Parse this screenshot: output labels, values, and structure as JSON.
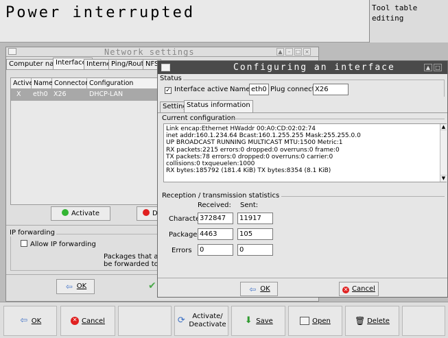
{
  "header": {
    "title": "Power interrupted",
    "mode_label": "Tool table\nediting"
  },
  "network_window": {
    "title": "Network settings",
    "tabs": [
      "Computer name",
      "Interfaces",
      "Internet",
      "Ping/Routing",
      "NFS"
    ],
    "columns": [
      "Active",
      "Name",
      "Connectors",
      "Configuration"
    ],
    "rows": [
      {
        "active": "X",
        "name": "eth0",
        "connectors": "X26",
        "configuration": "DHCP-LAN"
      }
    ],
    "activate_button": "Activate",
    "deactivate_button": "De",
    "ip_forwarding_group": "IP forwarding",
    "allow_ip_forwarding": "Allow IP forwarding",
    "forwarding_note_1": "Packages that ar",
    "forwarding_note_2": "be forwarded to o",
    "ok_button": "OK"
  },
  "dialog": {
    "title": "Configuring an interface",
    "status_group": "Status",
    "interface_active_label": "Interface active",
    "interface_active_checked": true,
    "name_label": "Name:",
    "name_value": "eth0",
    "plug_label": "Plug connection:",
    "plug_value": "X26",
    "tabs": [
      "Settings",
      "Status information"
    ],
    "current_config_group": "Current configuration",
    "config_lines": [
      "Link encap:Ethernet  HWaddr 00:A0:CD:02:02:74",
      "inet addr:160.1.234.64  Bcast:160.1.255.255  Mask:255.255.0.0",
      "UP BROADCAST RUNNING MULTICAST  MTU:1500  Metric:1",
      "RX packets:2215 errors:0 dropped:0 overruns:0 frame:0",
      "TX packets:78 errors:0 dropped:0 overruns:0 carrier:0",
      "collisions:0 txqueuelen:1000",
      "RX bytes:185792 (181.4 KiB)  TX bytes:8354 (8.1 KiB)"
    ],
    "stats_group": "Reception / transmission statistics",
    "received_header": "Received:",
    "sent_header": "Sent:",
    "stats": [
      {
        "label": "Character",
        "received": "372847",
        "sent": "11917"
      },
      {
        "label": "Packages",
        "received": "4463",
        "sent": "105"
      },
      {
        "label": "Errors",
        "received": "0",
        "sent": "0"
      }
    ],
    "ok_button": "OK",
    "cancel_button": "Cancel"
  },
  "softkeys": {
    "ok": "OK",
    "cancel": "Cancel",
    "activate_deactivate_1": "Activate/",
    "activate_deactivate_2": "Deactivate",
    "save": "Save",
    "open": "Open",
    "delete": "Delete"
  },
  "colors": {
    "dialog_title_bg": "#4a4a4a",
    "selection_row": "#a8a8a8",
    "activate_green": "#33b533",
    "deactivate_red": "#e02020",
    "softkey_bar_blue": "#0000c0"
  }
}
